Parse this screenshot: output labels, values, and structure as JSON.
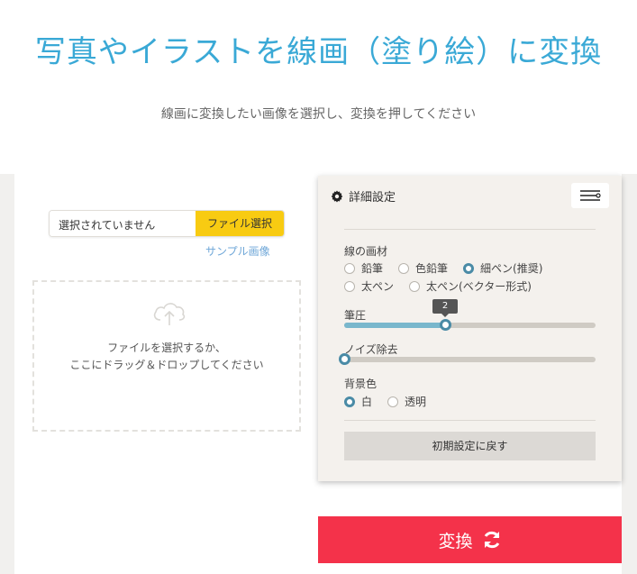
{
  "header": {
    "title": "写真やイラストを線画（塗り絵）に変換",
    "subtitle": "線画に変換したい画像を選択し、変換を押してください"
  },
  "upload": {
    "file_input_value": "選択されていません",
    "file_button_label": "ファイル選択",
    "sample_link": "サンプル画像",
    "dropzone_line1": "ファイルを選択するか、",
    "dropzone_line2": "ここにドラッグ＆ドロップしてください",
    "icon": "cloud-upload-icon"
  },
  "settings": {
    "header_label": "詳細設定",
    "header_icon": "gear-icon",
    "menu_icon": "sliders-icon",
    "material": {
      "label": "線の画材",
      "options": [
        "鉛筆",
        "色鉛筆",
        "細ペン(推奨)",
        "太ペン",
        "太ペン(ベクター形式)"
      ],
      "selected": "細ペン(推奨)"
    },
    "pressure": {
      "label": "筆圧",
      "value": "2",
      "fraction": 0.4
    },
    "noise": {
      "label": "ノイズ除去",
      "fraction": 0.0
    },
    "background": {
      "label": "背景色",
      "options": [
        "白",
        "透明"
      ],
      "selected": "白"
    },
    "reset_label": "初期設定に戻す"
  },
  "convert": {
    "label": "変換",
    "icon": "refresh-icon",
    "color": "#f4324a"
  },
  "colors": {
    "title": "#3aa9d6",
    "accent": "#4a8ba6",
    "file_button": "#f8cb12"
  }
}
